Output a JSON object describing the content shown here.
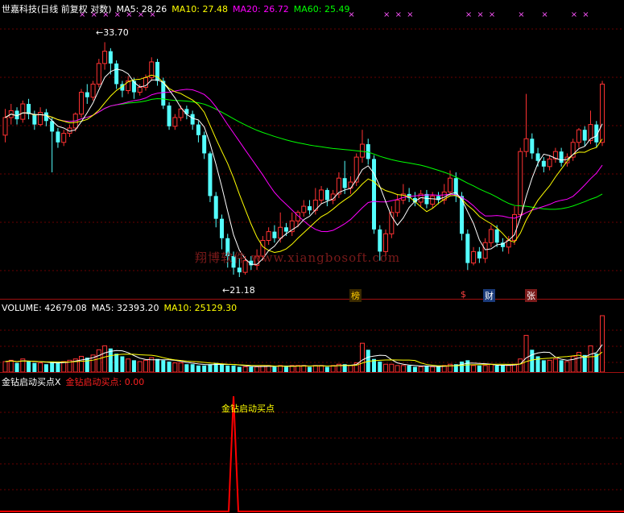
{
  "header": {
    "stock": "世嘉科技(日线 前复权 对数)",
    "ma5": "MA5: 28.26",
    "ma10": "MA10: 27.48",
    "ma20": "MA20: 26.72",
    "ma60": "MA60: 25.49"
  },
  "volume_header": {
    "volume": "VOLUME: 42679.08",
    "ma5": "MA5: 32393.20",
    "ma10": "MA10: 25129.30"
  },
  "indicator_header": {
    "name": "金钻启动买点X",
    "value": "金钻启动买点: 0.00"
  },
  "indicator_label": "金钻启动买点",
  "price_labels": {
    "high": "33.70",
    "low": "21.18"
  },
  "event_tags": [
    "榜",
    "$",
    "财",
    "张"
  ],
  "watermark": "翔博软件 www.xiangbosoft.com",
  "colors": {
    "ma5": "#ffffff",
    "ma10": "#ffff00",
    "ma20": "#ff00ff",
    "ma60": "#00ff00",
    "up": "#ff3232",
    "down": "#54ffff",
    "signal": "#ff0000",
    "header_red": "#ff2020"
  },
  "chart_data": {
    "type": "candlestick",
    "title": "世嘉科技(日线 前复权 对数)",
    "price_range": [
      20.5,
      35.5
    ],
    "scale": "log",
    "candles": [
      [
        28.0,
        29.0,
        27.6,
        29.5
      ],
      [
        29.0,
        29.4,
        28.6,
        29.8
      ],
      [
        29.4,
        28.9,
        28.6,
        29.6
      ],
      [
        28.9,
        29.8,
        28.7,
        30.0
      ],
      [
        29.8,
        29.2,
        28.9,
        30.1
      ],
      [
        29.2,
        28.6,
        28.3,
        29.4
      ],
      [
        28.6,
        29.3,
        28.5,
        29.6
      ],
      [
        29.3,
        28.8,
        28.5,
        29.5
      ],
      [
        28.8,
        28.2,
        26.0,
        29.0
      ],
      [
        28.2,
        27.6,
        27.3,
        28.4
      ],
      [
        27.6,
        28.1,
        27.4,
        28.3
      ],
      [
        28.1,
        28.4,
        27.9,
        28.6
      ],
      [
        28.4,
        29.2,
        28.2,
        29.3
      ],
      [
        29.2,
        30.5,
        29.0,
        30.7
      ],
      [
        30.5,
        30.2,
        29.8,
        31.0
      ],
      [
        30.2,
        31.0,
        30.0,
        31.2
      ],
      [
        31.0,
        32.3,
        30.8,
        32.6
      ],
      [
        32.3,
        33.1,
        31.9,
        33.7
      ],
      [
        33.1,
        32.3,
        31.6,
        33.3
      ],
      [
        32.3,
        31.0,
        30.7,
        32.5
      ],
      [
        31.0,
        30.6,
        30.2,
        31.2
      ],
      [
        30.6,
        31.2,
        30.4,
        31.5
      ],
      [
        31.2,
        30.5,
        30.1,
        31.4
      ],
      [
        30.5,
        30.8,
        30.3,
        31.0
      ],
      [
        30.8,
        31.4,
        30.6,
        31.6
      ],
      [
        31.4,
        32.4,
        31.2,
        32.7
      ],
      [
        32.4,
        31.2,
        30.9,
        32.6
      ],
      [
        31.2,
        29.7,
        29.5,
        31.4
      ],
      [
        29.7,
        28.5,
        28.3,
        29.9
      ],
      [
        28.5,
        29.0,
        28.3,
        29.2
      ],
      [
        29.0,
        29.5,
        28.8,
        29.7
      ],
      [
        29.5,
        29.2,
        28.9,
        29.7
      ],
      [
        29.2,
        28.6,
        28.3,
        29.4
      ],
      [
        28.6,
        28.0,
        27.6,
        28.8
      ],
      [
        28.0,
        27.0,
        26.7,
        28.2
      ],
      [
        27.0,
        24.8,
        24.5,
        27.1
      ],
      [
        24.8,
        23.7,
        23.3,
        25.0
      ],
      [
        23.7,
        22.8,
        22.3,
        23.9
      ],
      [
        22.8,
        22.0,
        21.5,
        23.0
      ],
      [
        22.0,
        21.5,
        21.2,
        22.2
      ],
      [
        21.5,
        21.3,
        21.1,
        21.9
      ],
      [
        21.3,
        21.8,
        21.2,
        22.0
      ],
      [
        21.8,
        21.6,
        21.4,
        22.0
      ],
      [
        21.6,
        22.0,
        21.4,
        22.3
      ],
      [
        22.0,
        22.7,
        21.8,
        22.9
      ],
      [
        22.7,
        23.1,
        22.5,
        23.3
      ],
      [
        23.1,
        22.8,
        22.6,
        23.4
      ],
      [
        22.8,
        23.3,
        22.6,
        24.0
      ],
      [
        23.3,
        23.1,
        22.9,
        23.5
      ],
      [
        23.1,
        23.6,
        22.9,
        24.0
      ],
      [
        23.6,
        24.0,
        23.3,
        24.1
      ],
      [
        24.0,
        24.3,
        23.8,
        24.6
      ],
      [
        24.3,
        24.1,
        23.9,
        24.6
      ],
      [
        24.1,
        24.6,
        23.9,
        25.2
      ],
      [
        24.6,
        25.1,
        24.4,
        25.3
      ],
      [
        25.1,
        24.6,
        24.3,
        25.2
      ],
      [
        24.6,
        24.9,
        24.4,
        25.1
      ],
      [
        24.9,
        25.7,
        24.7,
        26.0
      ],
      [
        25.7,
        25.2,
        24.9,
        26.6
      ],
      [
        25.2,
        25.5,
        24.9,
        25.8
      ],
      [
        25.5,
        26.8,
        25.3,
        27.0
      ],
      [
        26.8,
        27.5,
        26.5,
        28.3
      ],
      [
        27.5,
        26.7,
        26.4,
        27.8
      ],
      [
        26.7,
        23.2,
        23.0,
        26.9
      ],
      [
        23.2,
        22.2,
        21.8,
        23.4
      ],
      [
        22.2,
        23.0,
        22.0,
        23.2
      ],
      [
        23.0,
        24.0,
        22.8,
        24.3
      ],
      [
        24.0,
        24.6,
        23.8,
        24.9
      ],
      [
        24.6,
        24.9,
        24.4,
        25.4
      ],
      [
        24.9,
        24.7,
        24.5,
        25.2
      ],
      [
        24.7,
        24.5,
        24.3,
        25.0
      ],
      [
        24.5,
        24.9,
        24.3,
        25.1
      ],
      [
        24.9,
        24.4,
        24.2,
        25.1
      ],
      [
        24.4,
        24.8,
        24.2,
        25.0
      ],
      [
        24.8,
        24.6,
        24.4,
        25.0
      ],
      [
        24.6,
        25.0,
        24.4,
        25.4
      ],
      [
        25.0,
        25.7,
        24.8,
        26.1
      ],
      [
        25.7,
        24.8,
        24.5,
        26.0
      ],
      [
        24.8,
        23.0,
        22.7,
        25.0
      ],
      [
        23.0,
        21.7,
        21.4,
        23.2
      ],
      [
        21.7,
        22.2,
        21.6,
        22.4
      ],
      [
        22.2,
        21.9,
        21.7,
        22.4
      ],
      [
        21.9,
        22.6,
        21.7,
        22.8
      ],
      [
        22.6,
        23.2,
        22.4,
        23.4
      ],
      [
        23.2,
        22.6,
        22.4,
        23.4
      ],
      [
        22.6,
        22.4,
        22.2,
        22.8
      ],
      [
        22.4,
        22.7,
        22.1,
        22.9
      ],
      [
        22.7,
        23.9,
        22.5,
        24.3
      ],
      [
        23.9,
        27.1,
        23.7,
        27.3
      ],
      [
        27.1,
        27.8,
        26.8,
        30.4
      ],
      [
        27.8,
        27.0,
        26.7,
        28.1
      ],
      [
        27.0,
        26.6,
        26.3,
        27.3
      ],
      [
        26.6,
        26.3,
        26.0,
        26.8
      ],
      [
        26.3,
        26.7,
        26.1,
        26.9
      ],
      [
        26.7,
        27.1,
        26.5,
        27.3
      ],
      [
        27.1,
        26.5,
        26.3,
        27.3
      ],
      [
        26.5,
        26.8,
        26.3,
        27.0
      ],
      [
        26.8,
        27.6,
        26.6,
        27.8
      ],
      [
        27.6,
        28.3,
        27.3,
        28.4
      ],
      [
        28.3,
        27.7,
        27.4,
        28.5
      ],
      [
        27.7,
        28.6,
        27.5,
        29.4
      ],
      [
        28.6,
        27.6,
        27.3,
        28.8
      ],
      [
        27.6,
        31.0,
        27.4,
        31.2
      ]
    ],
    "volume": [
      8,
      9,
      7,
      10,
      8,
      7,
      7,
      6,
      8,
      7,
      8,
      9,
      10,
      12,
      11,
      13,
      17,
      20,
      18,
      14,
      12,
      10,
      9,
      8,
      9,
      11,
      10,
      9,
      8,
      7,
      7,
      6,
      6,
      5,
      5,
      6,
      7,
      6,
      5,
      5,
      4,
      4,
      4,
      4,
      5,
      5,
      4,
      5,
      4,
      5,
      5,
      5,
      4,
      5,
      5,
      4,
      5,
      6,
      6,
      5,
      7,
      22,
      17,
      10,
      8,
      6,
      6,
      5,
      5,
      5,
      4,
      4,
      5,
      4,
      4,
      5,
      6,
      6,
      8,
      9,
      5,
      5,
      5,
      6,
      5,
      5,
      5,
      6,
      10,
      28,
      17,
      12,
      9,
      9,
      10,
      9,
      8,
      12,
      15,
      13,
      20,
      14,
      43
    ],
    "indicator": {
      "name": "金钻启动买点",
      "signal_index": 39,
      "signal_value": 1,
      "current_value": 0.0
    }
  }
}
